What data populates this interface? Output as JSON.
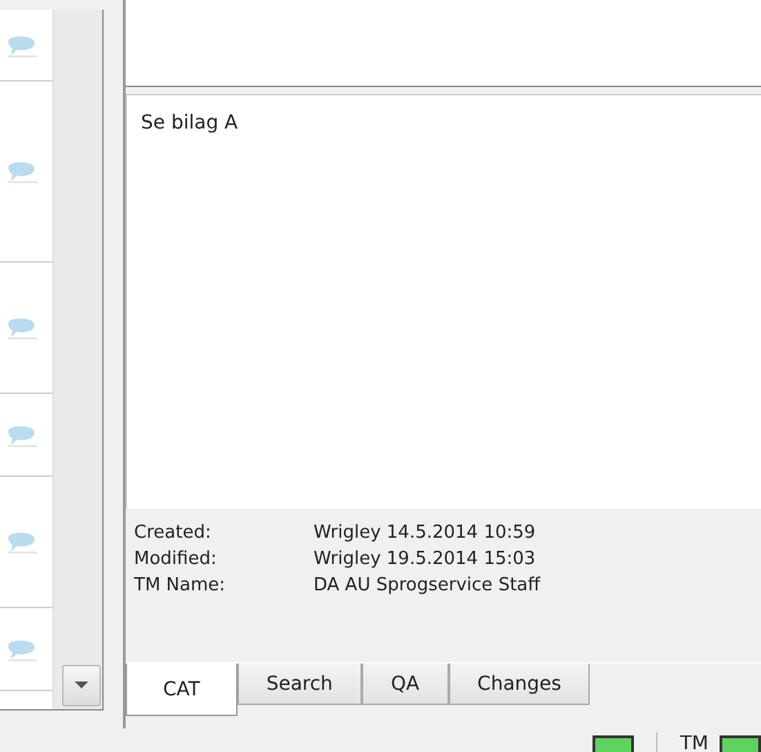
{
  "comment_list": {
    "rows": [
      {
        "kind": "comment"
      },
      {
        "kind": "comment"
      },
      {
        "kind": "comment"
      },
      {
        "kind": "comment"
      },
      {
        "kind": "comment"
      },
      {
        "kind": "comment"
      }
    ]
  },
  "comment_text": "Se bilag A",
  "info": [
    {
      "label": "Created:",
      "value": "Wrigley 14.5.2014 10:59"
    },
    {
      "label": "Modified:",
      "value": "Wrigley 19.5.2014 15:03"
    },
    {
      "label": "TM Name:",
      "value": "DA AU Sprogservice Staff"
    }
  ],
  "tabs": [
    {
      "label": "CAT",
      "selected": true
    },
    {
      "label": "Search",
      "selected": false
    },
    {
      "label": "QA",
      "selected": false
    },
    {
      "label": "Changes",
      "selected": false
    }
  ],
  "status_bar": {
    "tm_label": "TM"
  }
}
